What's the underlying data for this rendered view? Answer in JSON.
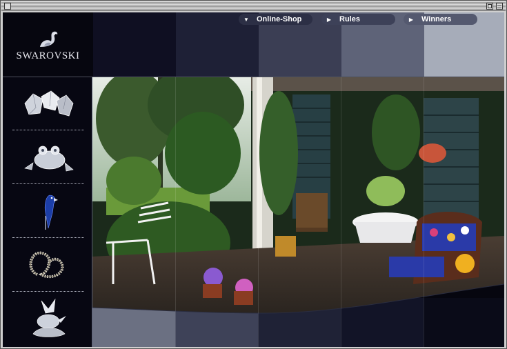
{
  "window": {
    "close_icon": "close-box",
    "zoom_icon": "zoom-box",
    "collapse_icon": "collapse-box"
  },
  "brand": {
    "name": "SWAROVSKI",
    "logo_icon": "swan-logo-icon"
  },
  "nav": {
    "items": [
      {
        "label": "Online-Shop",
        "icon": "triangle-down-icon"
      },
      {
        "label": "Rules",
        "icon": "triangle-right-icon"
      },
      {
        "label": "Winners",
        "icon": "triangle-right-icon"
      }
    ]
  },
  "sidebar": {
    "items": [
      {
        "icon": "crystal-cluster-icon"
      },
      {
        "icon": "crystal-frog-icon"
      },
      {
        "icon": "crystal-parrot-icon"
      },
      {
        "icon": "crystal-jewelry-icon"
      },
      {
        "icon": "crystal-bird-figure-icon"
      }
    ]
  },
  "hero": {
    "image_icon": "garden-patio-photo"
  },
  "colors": {
    "background": "#06060f",
    "band_1": "#0f0f22",
    "band_2": "#1e2036",
    "band_3": "#3b3e54",
    "band_4": "#5e6378",
    "band_5": "#a6acb9",
    "nav_text": "#ffffff"
  }
}
